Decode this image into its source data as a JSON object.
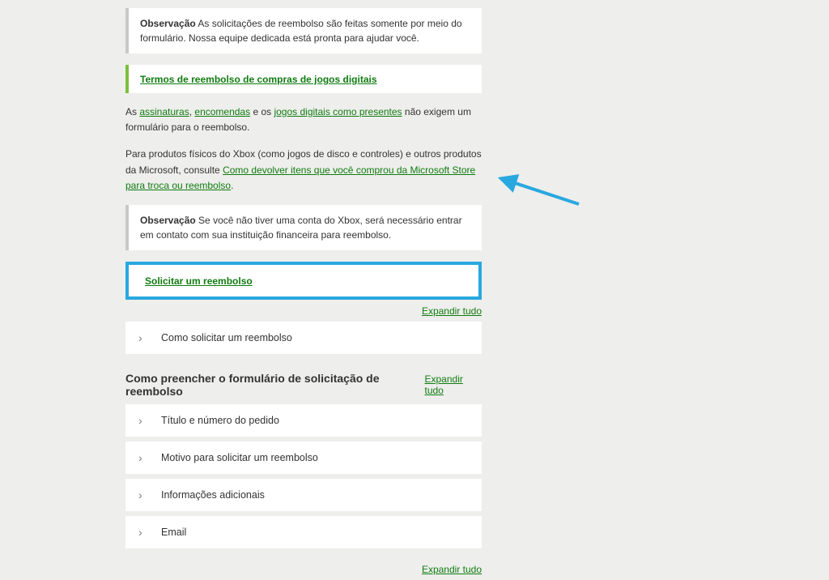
{
  "callout1": {
    "bold": "Observação",
    "text": " As solicitações de reembolso são feitas somente por meio do formulário. Nossa equipe dedicada está pronta para ajudar você."
  },
  "terms_link": "Termos de reembolso de compras de jogos digitais",
  "para1": {
    "prefix": "As ",
    "link1": "assinaturas",
    "sep1": ", ",
    "link2": "encomendas",
    "sep2": " e os ",
    "link3": "jogos digitais como presentes",
    "suffix": " não exigem um formulário para o reembolso."
  },
  "para2": {
    "line1": "Para produtos físicos do Xbox (como jogos de disco e controles) e outros produtos da Microsoft, consulte ",
    "link": "Como devolver itens que você comprou da Microsoft Store para troca ou reembolso",
    "period": "."
  },
  "callout2": {
    "bold": "Observação",
    "text": " Se você não tiver uma conta do Xbox, será necessário entrar em contato com sua instituição financeira para reembolso."
  },
  "cta": "Solicitar um reembolso",
  "expand": "Expandir tudo",
  "accordion1": "Como solicitar um reembolso",
  "section2_title": "Como preencher o formulário de solicitação de reembolso",
  "accordion2": "Título e número do pedido",
  "accordion3": "Motivo para solicitar um reembolso",
  "accordion4": "Informações adicionais",
  "accordion5": "Email",
  "expand2": "Expandir tudo"
}
